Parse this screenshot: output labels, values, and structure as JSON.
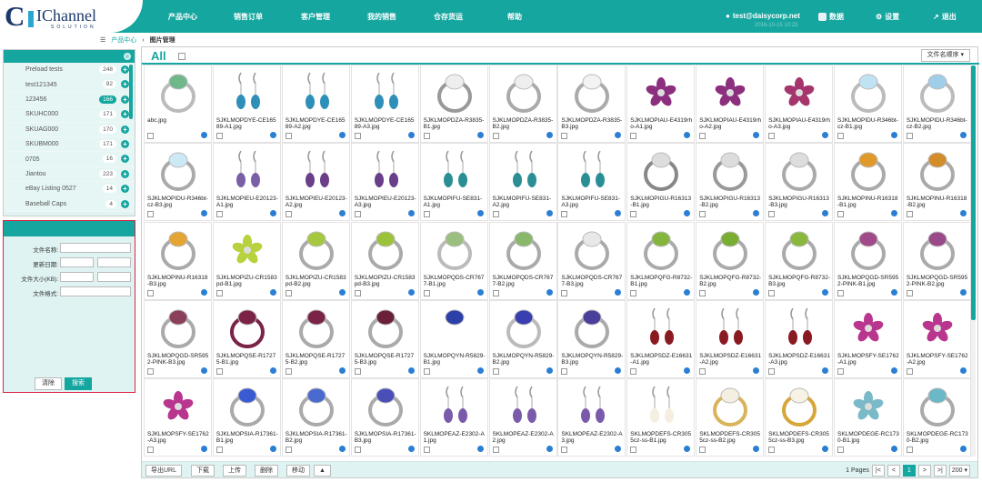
{
  "brand": {
    "letter": "C",
    "name": "IChannel",
    "tagline": "SOLUTION"
  },
  "nav": [
    "产品中心",
    "销售订单",
    "客户管理",
    "我的销售",
    "仓存货运",
    "帮助"
  ],
  "user": {
    "email": "test@daisycorp.net",
    "sub": "2016-10-15 10:23",
    "data": "数据",
    "settings": "设置",
    "logout": "退出"
  },
  "breadcrumb": {
    "home": "产品中心",
    "current": "图片管理"
  },
  "folders": [
    {
      "name": "Preload tests",
      "count": "248"
    },
    {
      "name": "test121345",
      "count": "92"
    },
    {
      "name": "123456",
      "count": "166"
    },
    {
      "name": "SKUHC000",
      "count": "171"
    },
    {
      "name": "SKUAG000",
      "count": "170"
    },
    {
      "name": "SKUBM000",
      "count": "171"
    },
    {
      "name": "0705",
      "count": "16"
    },
    {
      "name": "Jiantou",
      "count": "223"
    },
    {
      "name": "eBay Listing 0527",
      "count": "14"
    },
    {
      "name": "Baseball Caps",
      "count": "4"
    }
  ],
  "search": {
    "filename": "文件名称:",
    "updated": "更新日期:",
    "size": "文件大小(KB):",
    "format": "文件格式:",
    "clear": "清除",
    "submit": "搜索"
  },
  "main": {
    "all": "All",
    "sort": "文件名顺序 ▾"
  },
  "files": [
    "abc.jpg",
    "SJKLMOPDYE-CE16589-A1.jpg",
    "SJKLMOPDYE-CE16589-A2.jpg",
    "SJKLMOPDYE-CE16589-A3.jpg",
    "SJKLMOPDZA-R3835-B1.jpg",
    "SJKLMOPDZA-R3835-B2.jpg",
    "SJKLMOPDZA-R3835-B3.jpg",
    "SJKLMOPIAU-E4319rho-A1.jpg",
    "SJKLMOPIAU-E4319rho-A2.jpg",
    "SJKLMOPIAU-E4319rho-A3.jpg",
    "SJKLMOPIDU-R346bt-cz-B1.jpg",
    "SJKLMOPIDU-R346bt-cz-B2.jpg",
    "SJKLMOPIDU-R346bt-cz-B3.jpg",
    "SJKLMOPIEU-E20123-A1.jpg",
    "SJKLMOPIEU-E20123-A2.jpg",
    "SJKLMOPIEU-E20123-A3.jpg",
    "SJKLMOPIFU-SE831-A1.jpg",
    "SJKLMOPIFU-SE831-A2.jpg",
    "SJKLMOPIFU-SE831-A3.jpg",
    "SJKLMOPIGU-R16313-B1.jpg",
    "SJKLMOPIGU-R16313-B2.jpg",
    "SJKLMOPIGU-R16313-B3.jpg",
    "SJKLMOPINU-R16318-B1.jpg",
    "SJKLMOPINU-R16318-B2.jpg",
    "SJKLMOPINU-R16318-B3.jpg",
    "SJKLMOPIZU-CR1583pd-B1.jpg",
    "SJKLMOPIZU-CR1583pd-B2.jpg",
    "SJKLMOPIZU-CR1583pd-B3.jpg",
    "SJKLMOPQDS-CR7677-B1.jpg",
    "SJKLMOPQDS-CR7677-B2.jpg",
    "SJKLMOPQDS-CR7677-B3.jpg",
    "SJKLMOPQFG-R8732-B1.jpg",
    "SJKLMOPQFG-R8732-B2.jpg",
    "SJKLMOPQFG-R8732-B3.jpg",
    "SJKLMOPQGD-SR5952-PINK-B1.jpg",
    "SJKLMOPQGD-SR5952-PINK-B2.jpg",
    "SJKLMOPQGD-SR5952-PINK-B3.jpg",
    "SJKLMOPQSE-R17275-B1.jpg",
    "SJKLMOPQSE-R17275-B2.jpg",
    "SJKLMOPQSE-R17275-B3.jpg",
    "SJKLMOPQYN-R5829-B1.jpg",
    "SJKLMOPQYN-R5829-B2.jpg",
    "SJKLMOPQYN-R5829-B3.jpg",
    "SJKLMOPSDZ-E16631-A1.jpg",
    "SJKLMOPSDZ-E16631-A2.jpg",
    "SJKLMOPSDZ-E16631-A3.jpg",
    "SJKLMOPSFY-SE1762-A1.jpg",
    "SJKLMOPSFY-SE1762-A2.jpg",
    "SJKLMOPSFY-SE1762-A3.jpg",
    "SJKLMOPSIA-R17361-B1.jpg",
    "SJKLMOPSIA-R17361-B2.jpg",
    "SJKLMOPSIA-R17361-B3.jpg",
    "SKLMOPEAZ-E2302-A1.jpg",
    "SKLMOPEAZ-E2302-A2.jpg",
    "SKLMOPEAZ-E2302-A3.jpg",
    "SKLMOPDEFS-CR3055cz-ss-B1.jpg",
    "SKLMOPDEFS-CR3055cz-ss-B2.jpg",
    "SKLMOPDEFS-CR3055cz-ss-B3.jpg",
    "SKLMOPDEGE-RC1730-B1.jpg",
    "SKLMOPDEGE-RC1730-B2.jpg"
  ],
  "bottom": {
    "export": "导出URL",
    "download": "下载",
    "upload": "上传",
    "delete": "删除",
    "move": "移动",
    "move_arrow": "▲",
    "pages_label": "1 Pages",
    "first": "|<",
    "prev": "<",
    "current": "1",
    "next": ">",
    "last": ">|",
    "per_page": "200 ▾"
  }
}
